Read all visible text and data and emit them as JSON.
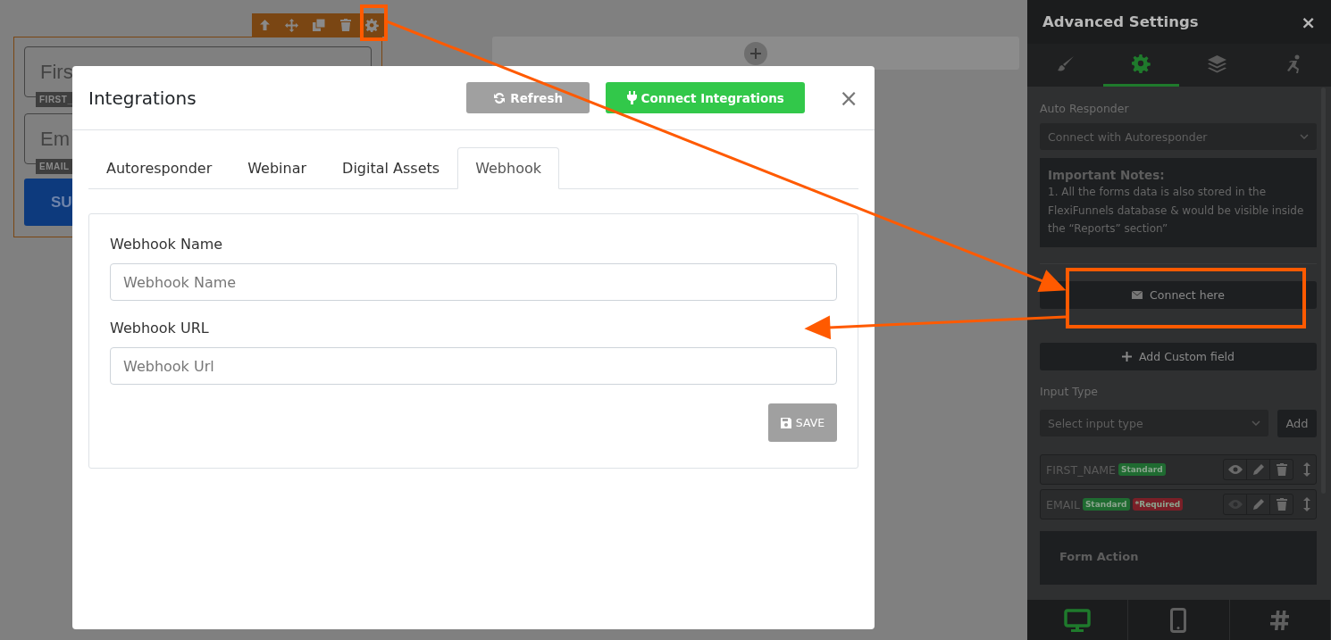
{
  "form_preview": {
    "fields": [
      {
        "text": "Firs",
        "tag": "FIRST_"
      },
      {
        "text": "Em",
        "tag": "EMAIL"
      }
    ],
    "button": "SU"
  },
  "modal": {
    "title": "Integrations",
    "buttons": [
      {
        "label": "Refresh",
        "kind": "refresh"
      },
      {
        "label": "Connect Integrations",
        "kind": "connect"
      }
    ],
    "close": "×",
    "tabs": [
      {
        "label": "Autoresponder",
        "selected": false
      },
      {
        "label": "Webinar",
        "selected": false
      },
      {
        "label": "Digital Assets",
        "selected": false
      },
      {
        "label": "Webhook",
        "selected": true
      }
    ],
    "form": {
      "fields": [
        {
          "label": "Webhook Name",
          "placeholder": "Webhook Name"
        },
        {
          "label": "Webhook URL",
          "placeholder": "Webhook Url"
        }
      ],
      "save": "SAVE"
    }
  },
  "panel": {
    "title": "Advanced Settings",
    "close": "×",
    "tabs": [
      {
        "kind": "brush",
        "selected": false
      },
      {
        "kind": "gear",
        "selected": true
      },
      {
        "kind": "layers",
        "selected": false
      },
      {
        "kind": "figure",
        "selected": false
      }
    ],
    "auto_responder": {
      "label": "Auto Responder",
      "select": "Connect with Autoresponder"
    },
    "notes": {
      "title": "Important Notes:",
      "text": "1. All the forms data is also stored in the FlexiFunnels database & would be visible inside the “Reports” section”"
    },
    "connect_button": "Connect here",
    "add_field_button": "Add Custom field",
    "input_type": {
      "label": "Input Type",
      "select": "Select input type",
      "add": "Add"
    },
    "fields": [
      {
        "name": "FIRST_NAME",
        "eye_disabled": false,
        "badges": [
          {
            "text": "Standard",
            "color": "#1f6b31"
          }
        ]
      },
      {
        "name": "EMAIL",
        "eye_disabled": true,
        "badges": [
          {
            "text": "Standard",
            "color": "#1f6b31"
          },
          {
            "text": "*Required",
            "color": "#7a1f27"
          }
        ]
      }
    ],
    "form_action": "Form Action",
    "devices": [
      {
        "kind": "desktop",
        "selected": true
      },
      {
        "kind": "mobile",
        "selected": false
      },
      {
        "kind": "hash",
        "selected": false
      }
    ]
  }
}
